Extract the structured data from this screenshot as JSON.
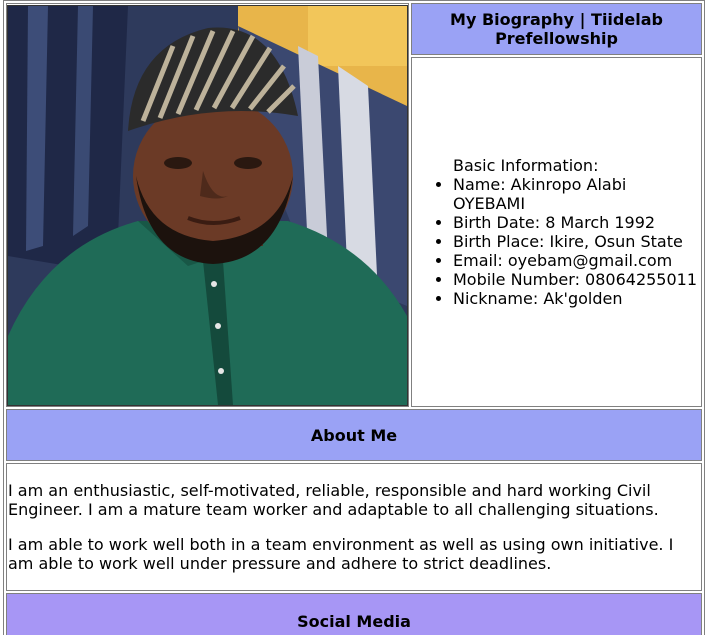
{
  "header": {
    "title": "My Biography | Tiidelab Prefellowship"
  },
  "basic_info": {
    "heading": "Basic Information:",
    "items": [
      "Name: Akinropo Alabi OYEBAMI",
      "Birth Date: 8 March 1992",
      "Birth Place: Ikire, Osun State",
      "Email: oyebam@gmail.com",
      "Mobile Number: 08064255011",
      "Nickname: Ak'golden"
    ]
  },
  "about": {
    "heading": "About Me",
    "paragraphs": [
      "I am an enthusiastic, self-motivated, reliable, responsible and hard working Civil Engineer. I am a mature team worker and adaptable to all challenging situations.",
      "I am able to work well both in a team environment as well as using own initiative. I am able to work well under pressure and adhere to strict deadlines."
    ]
  },
  "social": {
    "heading": "Social Media"
  },
  "colors": {
    "header_bg": "#9aa2f5",
    "social_bg": "#a796f5"
  }
}
